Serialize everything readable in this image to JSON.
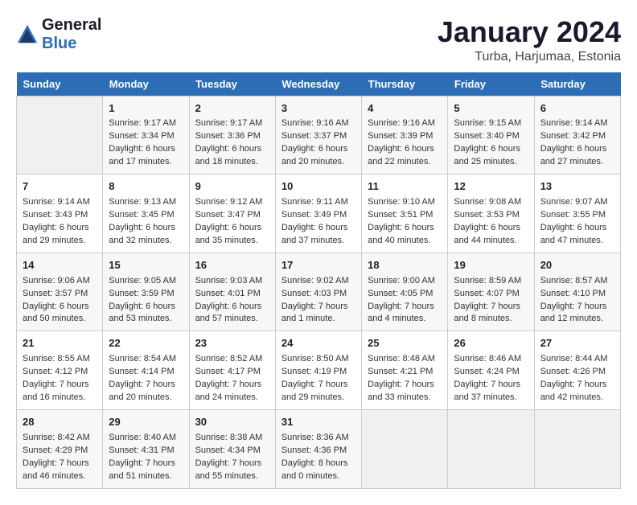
{
  "header": {
    "logo_line1": "General",
    "logo_line2": "Blue",
    "main_title": "January 2024",
    "subtitle": "Turba, Harjumaa, Estonia"
  },
  "weekdays": [
    "Sunday",
    "Monday",
    "Tuesday",
    "Wednesday",
    "Thursday",
    "Friday",
    "Saturday"
  ],
  "weeks": [
    [
      {
        "day": "",
        "info": ""
      },
      {
        "day": "1",
        "info": "Sunrise: 9:17 AM\nSunset: 3:34 PM\nDaylight: 6 hours\nand 17 minutes."
      },
      {
        "day": "2",
        "info": "Sunrise: 9:17 AM\nSunset: 3:36 PM\nDaylight: 6 hours\nand 18 minutes."
      },
      {
        "day": "3",
        "info": "Sunrise: 9:16 AM\nSunset: 3:37 PM\nDaylight: 6 hours\nand 20 minutes."
      },
      {
        "day": "4",
        "info": "Sunrise: 9:16 AM\nSunset: 3:39 PM\nDaylight: 6 hours\nand 22 minutes."
      },
      {
        "day": "5",
        "info": "Sunrise: 9:15 AM\nSunset: 3:40 PM\nDaylight: 6 hours\nand 25 minutes."
      },
      {
        "day": "6",
        "info": "Sunrise: 9:14 AM\nSunset: 3:42 PM\nDaylight: 6 hours\nand 27 minutes."
      }
    ],
    [
      {
        "day": "7",
        "info": "Sunrise: 9:14 AM\nSunset: 3:43 PM\nDaylight: 6 hours\nand 29 minutes."
      },
      {
        "day": "8",
        "info": "Sunrise: 9:13 AM\nSunset: 3:45 PM\nDaylight: 6 hours\nand 32 minutes."
      },
      {
        "day": "9",
        "info": "Sunrise: 9:12 AM\nSunset: 3:47 PM\nDaylight: 6 hours\nand 35 minutes."
      },
      {
        "day": "10",
        "info": "Sunrise: 9:11 AM\nSunset: 3:49 PM\nDaylight: 6 hours\nand 37 minutes."
      },
      {
        "day": "11",
        "info": "Sunrise: 9:10 AM\nSunset: 3:51 PM\nDaylight: 6 hours\nand 40 minutes."
      },
      {
        "day": "12",
        "info": "Sunrise: 9:08 AM\nSunset: 3:53 PM\nDaylight: 6 hours\nand 44 minutes."
      },
      {
        "day": "13",
        "info": "Sunrise: 9:07 AM\nSunset: 3:55 PM\nDaylight: 6 hours\nand 47 minutes."
      }
    ],
    [
      {
        "day": "14",
        "info": "Sunrise: 9:06 AM\nSunset: 3:57 PM\nDaylight: 6 hours\nand 50 minutes."
      },
      {
        "day": "15",
        "info": "Sunrise: 9:05 AM\nSunset: 3:59 PM\nDaylight: 6 hours\nand 53 minutes."
      },
      {
        "day": "16",
        "info": "Sunrise: 9:03 AM\nSunset: 4:01 PM\nDaylight: 6 hours\nand 57 minutes."
      },
      {
        "day": "17",
        "info": "Sunrise: 9:02 AM\nSunset: 4:03 PM\nDaylight: 7 hours\nand 1 minute."
      },
      {
        "day": "18",
        "info": "Sunrise: 9:00 AM\nSunset: 4:05 PM\nDaylight: 7 hours\nand 4 minutes."
      },
      {
        "day": "19",
        "info": "Sunrise: 8:59 AM\nSunset: 4:07 PM\nDaylight: 7 hours\nand 8 minutes."
      },
      {
        "day": "20",
        "info": "Sunrise: 8:57 AM\nSunset: 4:10 PM\nDaylight: 7 hours\nand 12 minutes."
      }
    ],
    [
      {
        "day": "21",
        "info": "Sunrise: 8:55 AM\nSunset: 4:12 PM\nDaylight: 7 hours\nand 16 minutes."
      },
      {
        "day": "22",
        "info": "Sunrise: 8:54 AM\nSunset: 4:14 PM\nDaylight: 7 hours\nand 20 minutes."
      },
      {
        "day": "23",
        "info": "Sunrise: 8:52 AM\nSunset: 4:17 PM\nDaylight: 7 hours\nand 24 minutes."
      },
      {
        "day": "24",
        "info": "Sunrise: 8:50 AM\nSunset: 4:19 PM\nDaylight: 7 hours\nand 29 minutes."
      },
      {
        "day": "25",
        "info": "Sunrise: 8:48 AM\nSunset: 4:21 PM\nDaylight: 7 hours\nand 33 minutes."
      },
      {
        "day": "26",
        "info": "Sunrise: 8:46 AM\nSunset: 4:24 PM\nDaylight: 7 hours\nand 37 minutes."
      },
      {
        "day": "27",
        "info": "Sunrise: 8:44 AM\nSunset: 4:26 PM\nDaylight: 7 hours\nand 42 minutes."
      }
    ],
    [
      {
        "day": "28",
        "info": "Sunrise: 8:42 AM\nSunset: 4:29 PM\nDaylight: 7 hours\nand 46 minutes."
      },
      {
        "day": "29",
        "info": "Sunrise: 8:40 AM\nSunset: 4:31 PM\nDaylight: 7 hours\nand 51 minutes."
      },
      {
        "day": "30",
        "info": "Sunrise: 8:38 AM\nSunset: 4:34 PM\nDaylight: 7 hours\nand 55 minutes."
      },
      {
        "day": "31",
        "info": "Sunrise: 8:36 AM\nSunset: 4:36 PM\nDaylight: 8 hours\nand 0 minutes."
      },
      {
        "day": "",
        "info": ""
      },
      {
        "day": "",
        "info": ""
      },
      {
        "day": "",
        "info": ""
      }
    ]
  ]
}
